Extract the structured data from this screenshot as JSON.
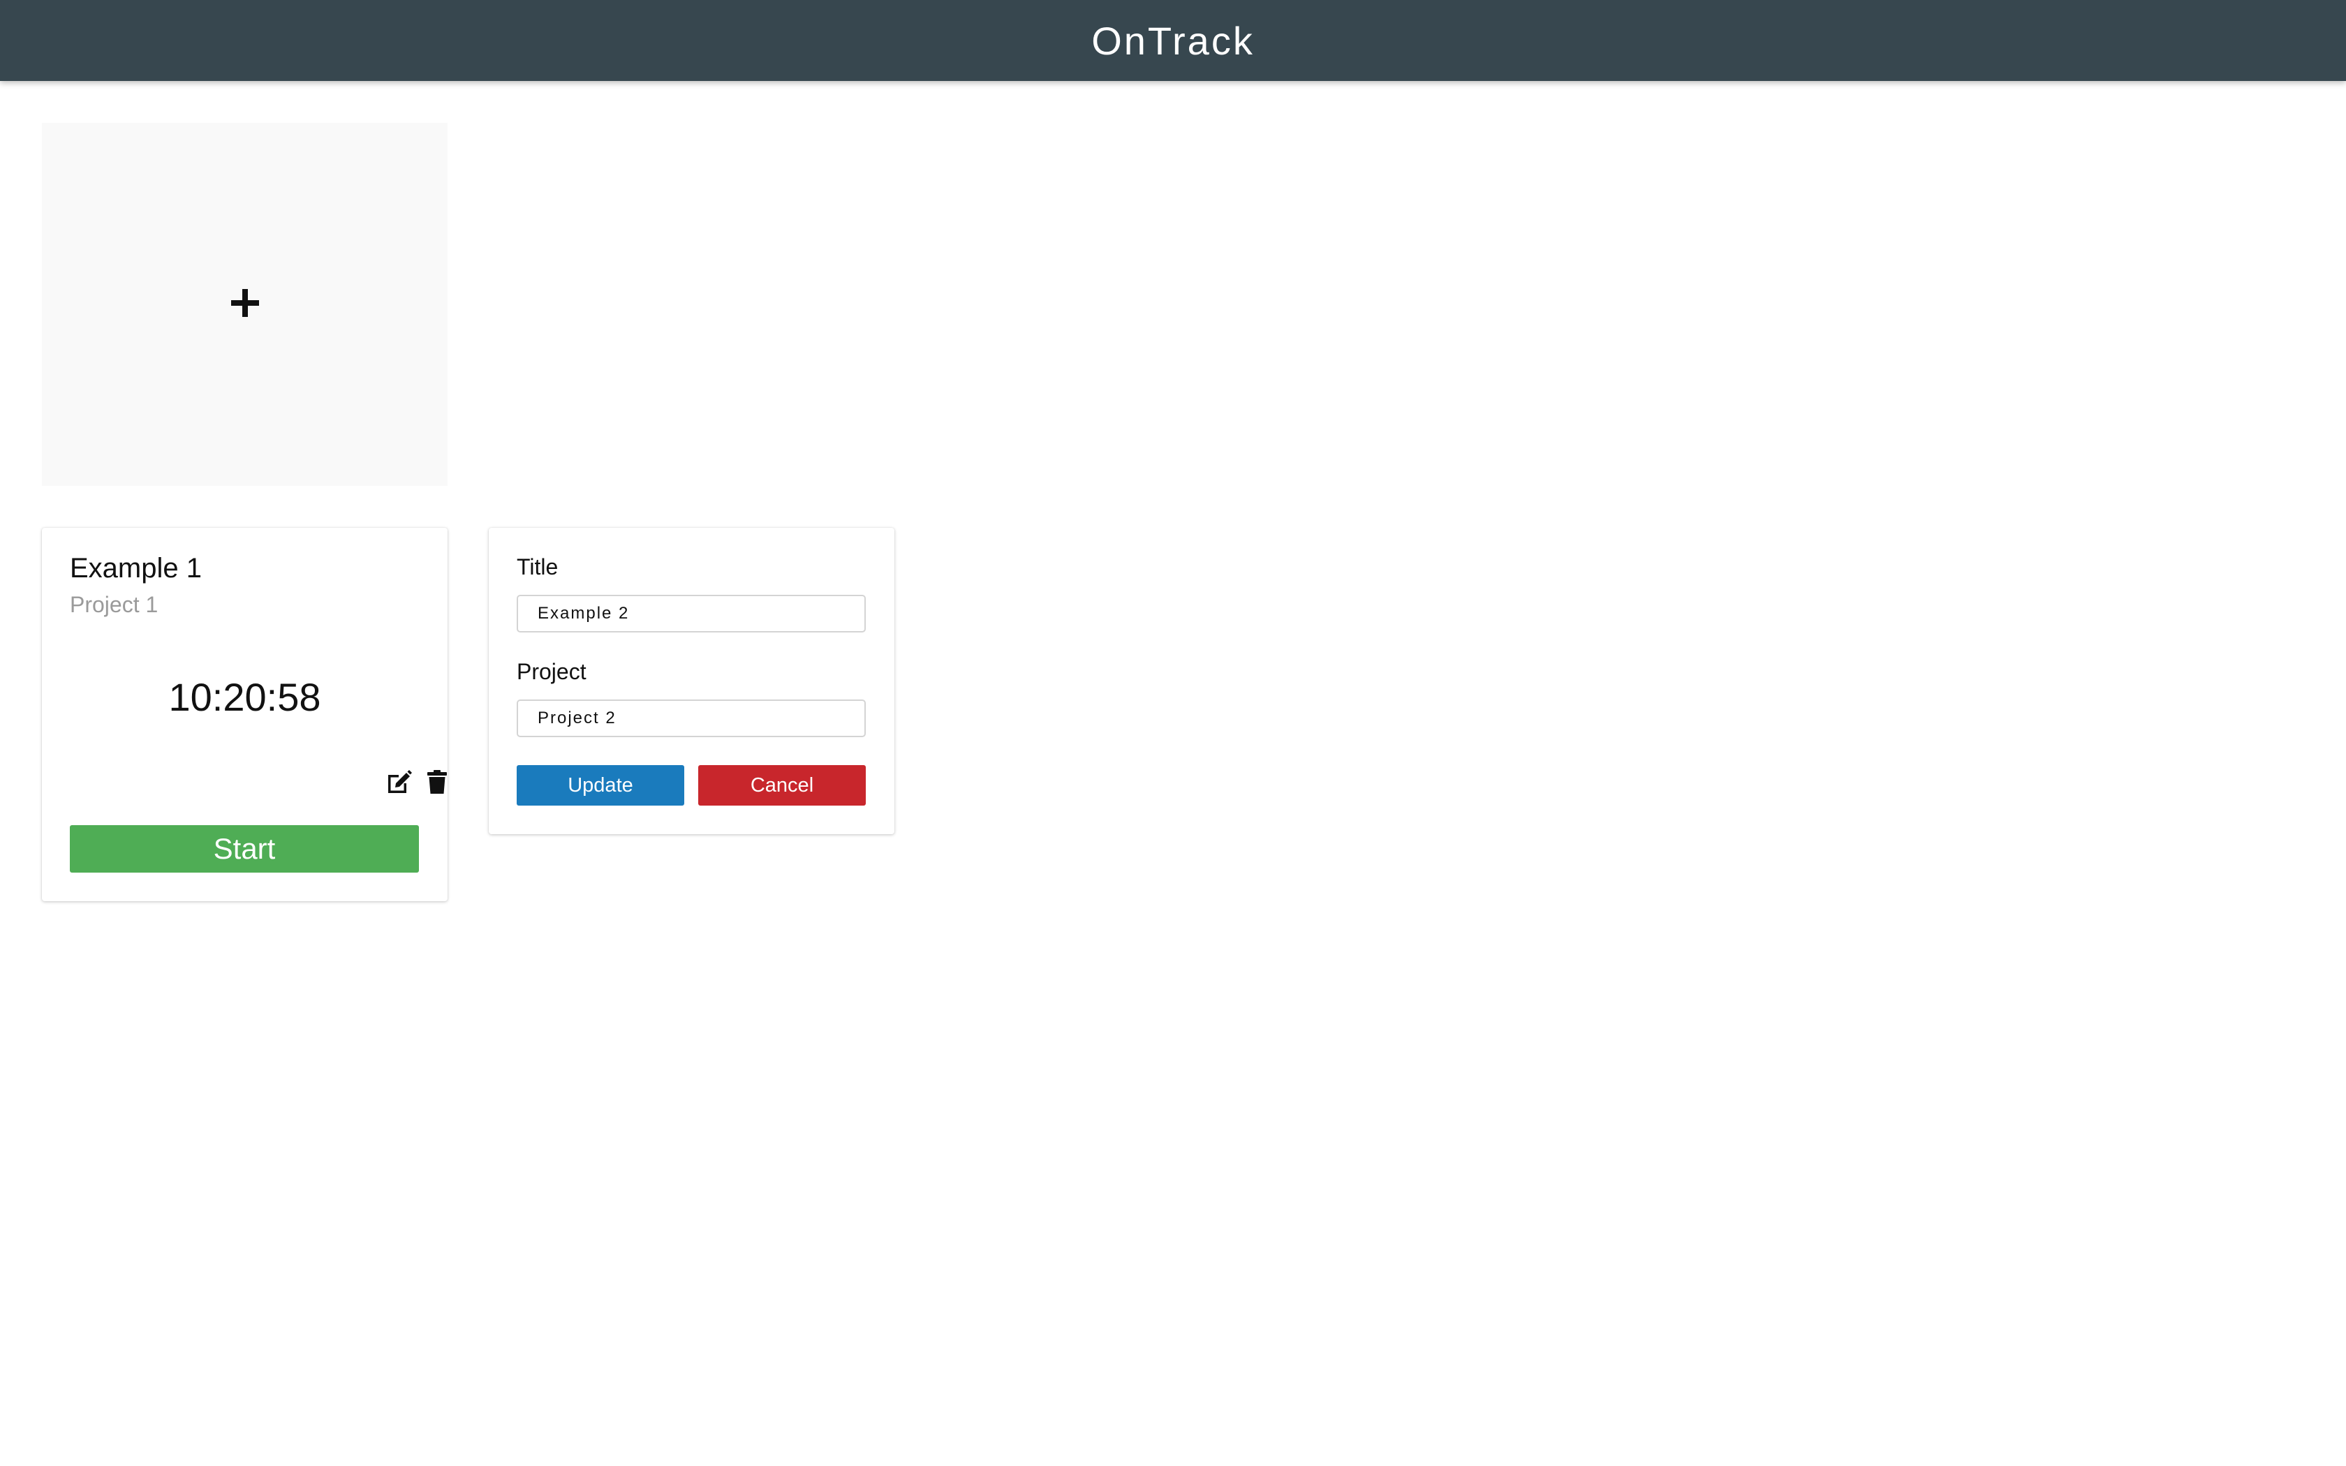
{
  "header": {
    "title": "OnTrack"
  },
  "add_card": {
    "icon": "plus-icon"
  },
  "timer_card": {
    "title": "Example 1",
    "project": "Project 1",
    "elapsed": "10:20:58",
    "edit_icon": "edit-icon",
    "delete_icon": "trash-icon",
    "start_label": "Start"
  },
  "edit_form": {
    "title_label": "Title",
    "title_value": "Example 2",
    "project_label": "Project",
    "project_value": "Project 2",
    "update_label": "Update",
    "cancel_label": "Cancel"
  },
  "colors": {
    "header_bg": "#37474f",
    "start": "#4fad55",
    "update": "#1a7bbd",
    "cancel": "#c8262c"
  }
}
